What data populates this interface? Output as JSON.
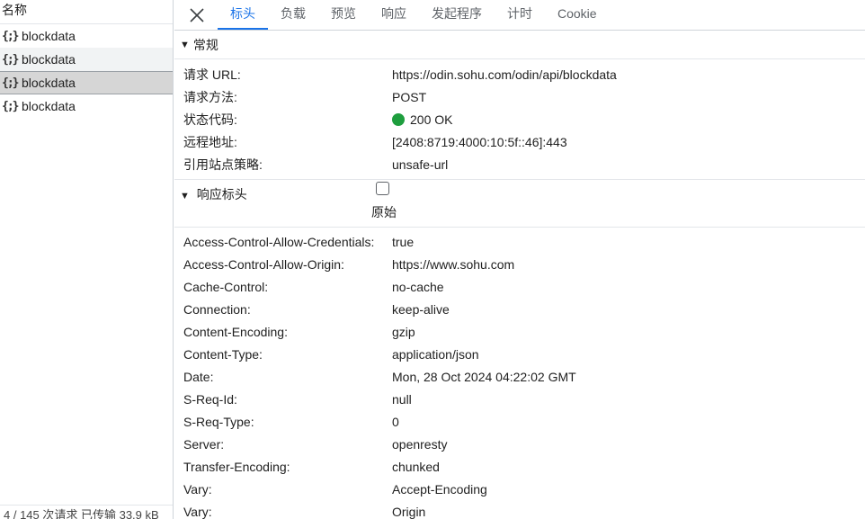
{
  "left_panel": {
    "header": "名称",
    "requests": [
      {
        "icon": "{;}",
        "name": "blockdata"
      },
      {
        "icon": "{;}",
        "name": "blockdata"
      },
      {
        "icon": "{;}",
        "name": "blockdata"
      },
      {
        "icon": "{;}",
        "name": "blockdata"
      }
    ],
    "selected_index": 2,
    "status_text": "4 / 145 次请求  已传输 33.9 kB"
  },
  "tabs": [
    "标头",
    "负载",
    "预览",
    "响应",
    "发起程序",
    "计时",
    "Cookie"
  ],
  "active_tab": 0,
  "general": {
    "title": "常规",
    "rows": [
      {
        "key": "请求 URL:",
        "value": "https://odin.sohu.com/odin/api/blockdata"
      },
      {
        "key": "请求方法:",
        "value": "POST"
      },
      {
        "key": "状态代码:",
        "value": "200 OK"
      },
      {
        "key": "远程地址:",
        "value": "[2408:8719:4000:10:5f::46]:443"
      },
      {
        "key": "引用站点策略:",
        "value": "unsafe-url"
      }
    ]
  },
  "response_headers": {
    "title": "响应标头",
    "raw_label": "原始",
    "rows": [
      {
        "key": "Access-Control-Allow-Credentials:",
        "value": "true"
      },
      {
        "key": "Access-Control-Allow-Origin:",
        "value": "https://www.sohu.com"
      },
      {
        "key": "Cache-Control:",
        "value": "no-cache"
      },
      {
        "key": "Connection:",
        "value": "keep-alive"
      },
      {
        "key": "Content-Encoding:",
        "value": "gzip"
      },
      {
        "key": "Content-Type:",
        "value": "application/json"
      },
      {
        "key": "Date:",
        "value": "Mon, 28 Oct 2024 04:22:02 GMT"
      },
      {
        "key": "S-Req-Id:",
        "value": "null"
      },
      {
        "key": "S-Req-Type:",
        "value": "0"
      },
      {
        "key": "Server:",
        "value": "openresty"
      },
      {
        "key": "Transfer-Encoding:",
        "value": "chunked"
      },
      {
        "key": "Vary:",
        "value": "Accept-Encoding"
      },
      {
        "key": "Vary:",
        "value": "Origin"
      }
    ]
  },
  "colors": {
    "accent": "#1a73e8",
    "status_ok": "#1e9e3e",
    "selected_row": "#d6d6d6"
  }
}
